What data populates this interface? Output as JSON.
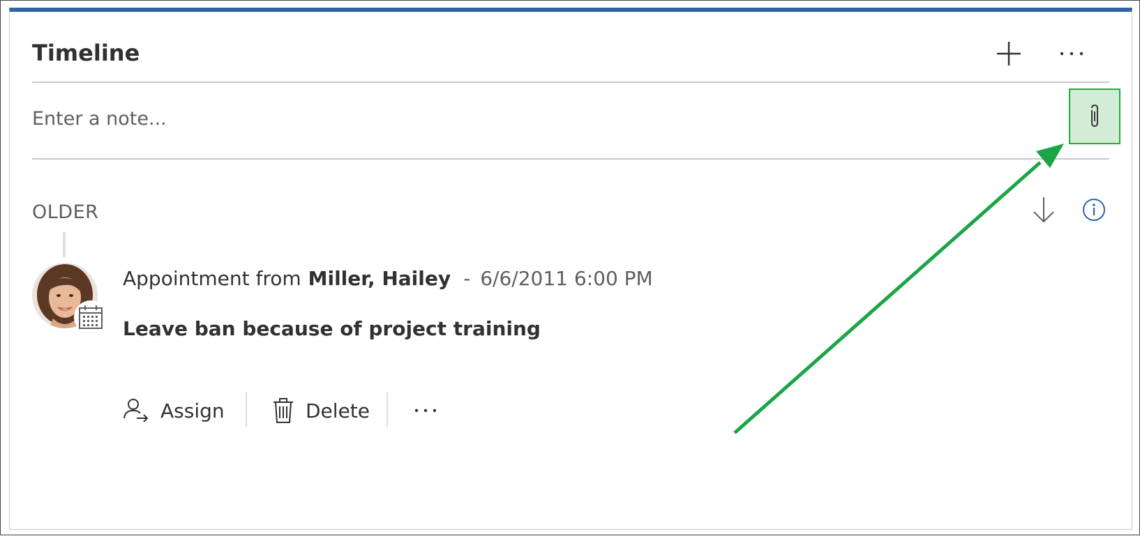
{
  "header": {
    "title": "Timeline"
  },
  "note": {
    "placeholder": "Enter a note..."
  },
  "section": {
    "label": "OLDER"
  },
  "record": {
    "type_label": "Appointment from",
    "owner": "Miller, Hailey",
    "separator": "-",
    "date": "6/6/2011 6:00 PM",
    "subject": "Leave ban because of project training"
  },
  "actions": {
    "assign_label": "Assign",
    "delete_label": "Delete"
  },
  "icons": {
    "add": "plus-icon",
    "more": "more-icon",
    "attach": "paperclip-icon",
    "sort": "arrow-down-icon",
    "info": "info-icon",
    "badge": "calendar-icon",
    "assign": "assign-user-icon",
    "delete": "trash-icon"
  },
  "colors": {
    "top_accent": "#2f64a8",
    "highlight_fill": "#d3ecd5",
    "highlight_border": "#22a947",
    "annotation_arrow": "#1aa647",
    "info_icon": "#2f64a8"
  }
}
